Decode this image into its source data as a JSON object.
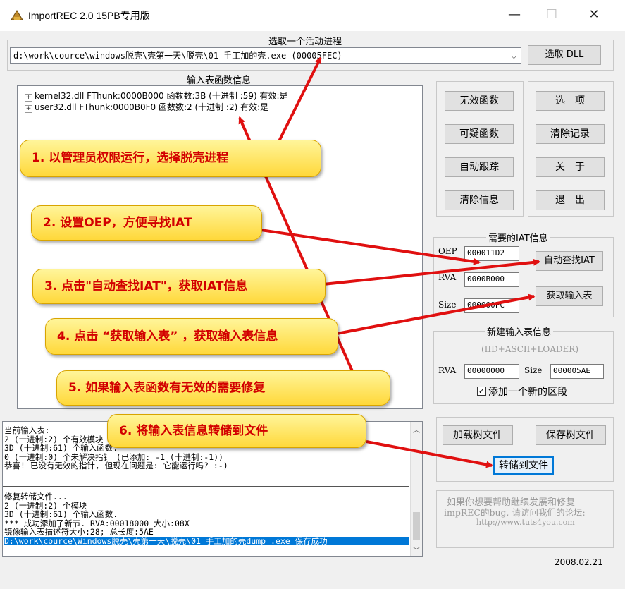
{
  "window": {
    "title": "ImportREC 2.0 15PB专用版",
    "minimize": "—",
    "maximize": "☐",
    "close": "✕"
  },
  "process": {
    "group_label": "选取一个活动进程",
    "selected": "d:\\work\\cource\\windows脱壳\\壳第一天\\脱壳\\01 手工加的壳.exe (00005FEC)",
    "pick_dll": "选取 DLL"
  },
  "imports": {
    "group_label": "输入表函数信息",
    "items": [
      "kernel32.dll FThunk:0000B000 函数数:3B (十进制 :59) 有效:是",
      "user32.dll FThunk:0000B0F0 函数数:2 (十进制 :2) 有效:是"
    ]
  },
  "buttons": {
    "invalid_funcs": "无效函数",
    "suspicious_funcs": "可疑函数",
    "auto_trace": "自动跟踪",
    "clear_info": "清除信息",
    "options": "选　项",
    "clear_log": "清除记录",
    "about": "关　于",
    "exit": "退　出",
    "load_tree": "加载树文件",
    "save_tree": "保存树文件",
    "dump_to_file": "转储到文件"
  },
  "iat": {
    "group_label": "需要的IAT信息",
    "oep_label": "OEP",
    "oep_value": "000011D2",
    "rva_label": "RVA",
    "rva_value": "0000B000",
    "size_label": "Size",
    "size_value": "000000FC",
    "auto_find": "自动查找IAT",
    "get_imports": "获取输入表"
  },
  "new_iat": {
    "group_label": "新建输入表信息",
    "subtitle": "(IID+ASCII+LOADER)",
    "rva_label": "RVA",
    "rva_value": "00000000",
    "size_label": "Size",
    "size_value": "000005AE",
    "add_section_checked": true,
    "add_section": "添加一个新的区段"
  },
  "log_top": [
    "当前输入表:",
    "2 (十进制:2) 个有效模块",
    "3D (十进制:61) 个输入函数.",
    "0 (十进制:0) 个未解决指针 (已添加: -1 (十进制:-1))",
    "恭喜! 已没有无效的指针, 但现在问题是: 它能运行吗? :-)"
  ],
  "log_bottom": [
    "修复转储文件...",
    "2 (十进制:2) 个模块",
    "3D (十进制:61) 个输入函数.",
    "*** 成功添加了新节. RVA:00018000 大小:08X",
    "镜像输入表描述符大小:28; 总长度:5AE"
  ],
  "log_selected": "D:\\work\\cource\\Windows脱壳\\壳第一天\\脱壳\\01 手工加的壳dump_.exe 保存成功",
  "promo": {
    "line1": "如果你想要帮助继续发展和修复",
    "line2": "impREC的bug, 请访问我们的论坛:",
    "url": "http://www.tuts4you.com"
  },
  "date": "2008.02.21",
  "callouts": {
    "c1": "1. 以管理员权限运行，选择脱壳进程",
    "c2": "2. 设置OEP，方便寻找IAT",
    "c3": "3. 点击\"自动查找IAT\"，获取IAT信息",
    "c4": "4. 点击 “获取输入表” ，获取输入表信息",
    "c5": "5. 如果输入表函数有无效的需要修复",
    "c6": "6. 将输入表信息转储到文件"
  },
  "colors": {
    "callout_text": "#d20000",
    "callout_fill": "#ffe14a",
    "arrow": "#e01010",
    "selection": "#0078d7"
  }
}
